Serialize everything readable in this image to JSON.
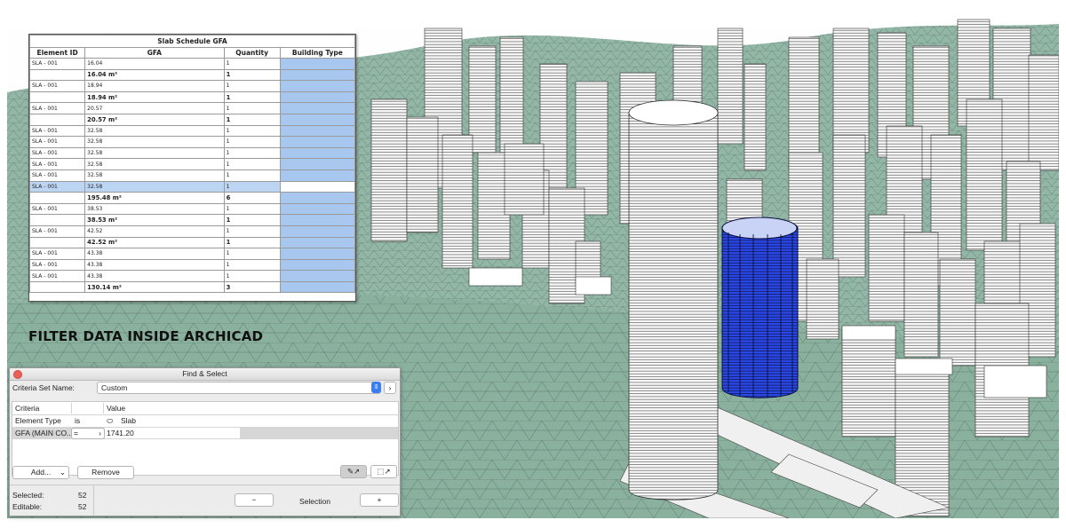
{
  "schedule": {
    "title": "Slab Schedule GFA",
    "headers": [
      "Element ID",
      "GFA",
      "Quantity",
      "Building Type"
    ],
    "rows": [
      {
        "id": "SLA - 001",
        "gfa": "16.04",
        "qty": "1",
        "subtotal": false
      },
      {
        "id": "",
        "gfa": "16.04 m²",
        "qty": "1",
        "subtotal": true
      },
      {
        "id": "SLA - 001",
        "gfa": "18.94",
        "qty": "1",
        "subtotal": false
      },
      {
        "id": "",
        "gfa": "18.94 m²",
        "qty": "1",
        "subtotal": true
      },
      {
        "id": "SLA - 001",
        "gfa": "20.57",
        "qty": "1",
        "subtotal": false
      },
      {
        "id": "",
        "gfa": "20.57 m²",
        "qty": "1",
        "subtotal": true
      },
      {
        "id": "SLA - 001",
        "gfa": "32.58",
        "qty": "1",
        "subtotal": false
      },
      {
        "id": "SLA - 001",
        "gfa": "32.58",
        "qty": "1",
        "subtotal": false
      },
      {
        "id": "SLA - 001",
        "gfa": "32.58",
        "qty": "1",
        "subtotal": false
      },
      {
        "id": "SLA - 001",
        "gfa": "32.58",
        "qty": "1",
        "subtotal": false
      },
      {
        "id": "SLA - 001",
        "gfa": "32.58",
        "qty": "1",
        "subtotal": false
      },
      {
        "id": "SLA - 001",
        "gfa": "32.58",
        "qty": "1",
        "subtotal": false,
        "selected": true
      },
      {
        "id": "",
        "gfa": "195.48 m²",
        "qty": "6",
        "subtotal": true
      },
      {
        "id": "SLA - 001",
        "gfa": "38.53",
        "qty": "1",
        "subtotal": false
      },
      {
        "id": "",
        "gfa": "38.53 m²",
        "qty": "1",
        "subtotal": true
      },
      {
        "id": "SLA - 001",
        "gfa": "42.52",
        "qty": "1",
        "subtotal": false
      },
      {
        "id": "",
        "gfa": "42.52 m²",
        "qty": "1",
        "subtotal": true
      },
      {
        "id": "SLA - 001",
        "gfa": "43.38",
        "qty": "1",
        "subtotal": false
      },
      {
        "id": "SLA - 001",
        "gfa": "43.38",
        "qty": "1",
        "subtotal": false
      },
      {
        "id": "SLA - 001",
        "gfa": "43.38",
        "qty": "1",
        "subtotal": false
      },
      {
        "id": "",
        "gfa": "130.14 m²",
        "qty": "3",
        "subtotal": true
      }
    ]
  },
  "caption": "FILTER DATA INSIDE ARCHICAD",
  "find_select": {
    "title": "Find & Select",
    "criteria_set_label": "Criteria Set Name:",
    "criteria_set_value": "Custom",
    "col_criteria": "Criteria",
    "col_value": "Value",
    "row1": {
      "criteria": "Element Type",
      "op": "is",
      "value": "Slab"
    },
    "row2": {
      "criteria": "GFA (MAIN CO...",
      "op": "=",
      "value": "1741.20"
    },
    "add_label": "Add...",
    "remove_label": "Remove",
    "selected_label": "Selected:",
    "selected_count": "52",
    "editable_label": "Editable:",
    "editable_count": "52",
    "minus_label": "−",
    "selection_label": "Selection",
    "plus_label": "+"
  },
  "colors": {
    "terrain": "#86ad9b",
    "terrain_light": "#a7c4b6",
    "tower_highlight": "#1f3fd8",
    "building": "#f5f5f5",
    "schedule_highlight": "#a8c7ef"
  }
}
